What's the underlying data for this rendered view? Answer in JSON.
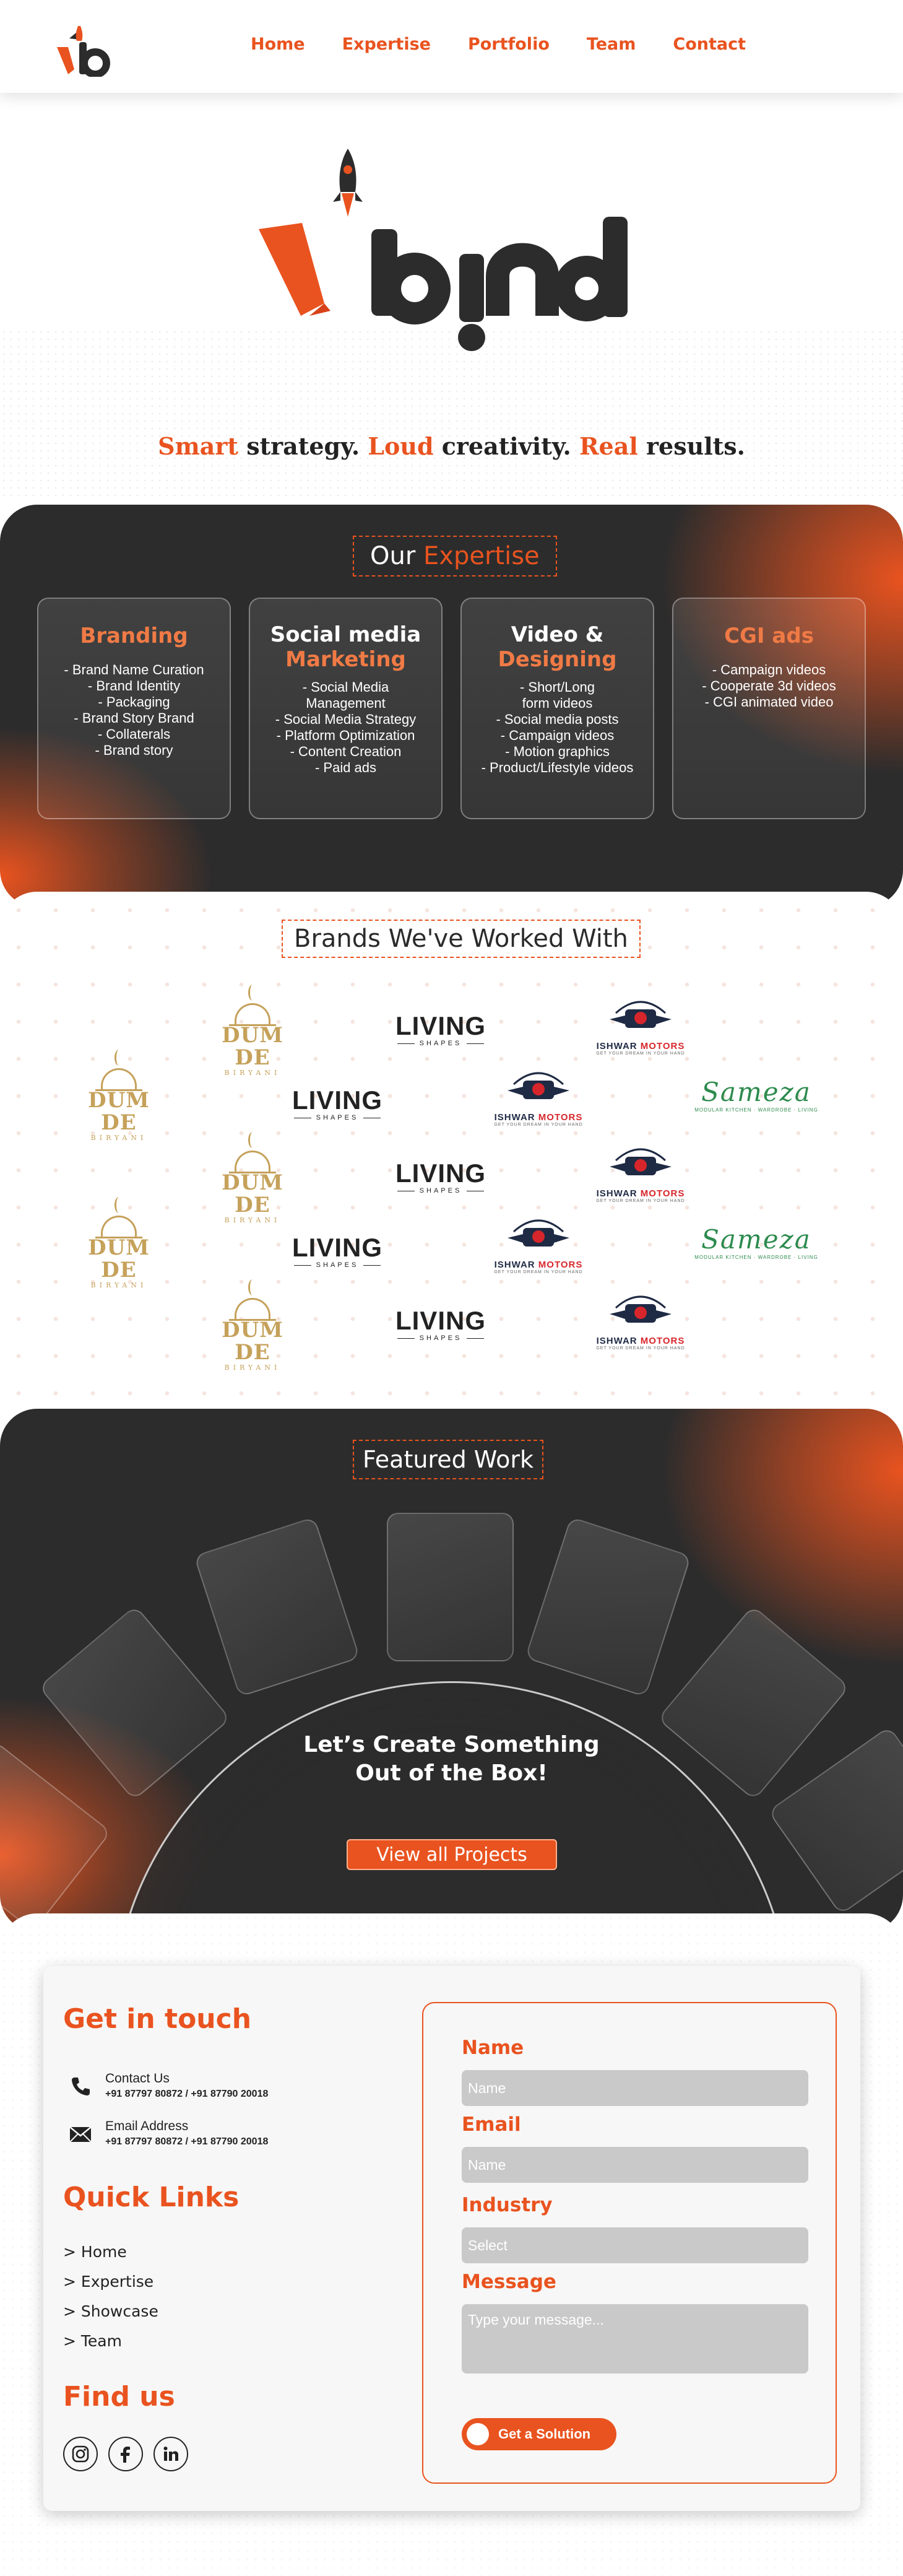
{
  "brand": {
    "logo_text": "vbind",
    "accent": "#E9531F",
    "dark": "#2C2C2C"
  },
  "nav": {
    "links": [
      "Home",
      "Expertise",
      "Portfolio",
      "Team",
      "Contact"
    ]
  },
  "hero": {
    "tagline": {
      "w1": "Smart",
      "t1": " strategy. ",
      "w2": "Loud",
      "t2": " creativity. ",
      "w3": "Real",
      "t3": " results."
    }
  },
  "expertise": {
    "title_a": "Our ",
    "title_b": "Expertise",
    "cards": [
      {
        "title_a": "Branding",
        "title_b": "",
        "items": [
          "- Brand Name Curation",
          "- Brand Identity",
          "- Packaging",
          "- Brand Story Brand",
          "- Collaterals",
          "- Brand story"
        ]
      },
      {
        "title_a": "Social media",
        "title_b": "Marketing",
        "items": [
          "- Social Media",
          "Management",
          "- Social Media Strategy",
          "- Platform Optimization",
          "- Content Creation",
          "- Paid ads"
        ]
      },
      {
        "title_a": "Video &",
        "title_b": "Designing",
        "items": [
          "- Short/Long",
          "form videos",
          "- Social media posts",
          "- Campaign videos",
          "- Motion graphics",
          "- Product/Lifestyle videos"
        ]
      },
      {
        "title_a": "CGI ads",
        "title_b": "",
        "items": [
          "- Campaign videos",
          "- Cooperate 3d videos",
          "- CGI animated video"
        ]
      }
    ]
  },
  "brands": {
    "title": "Brands We've Worked With",
    "dumde": {
      "name": "DUM DE",
      "sub": "BIRYANI"
    },
    "living": {
      "name": "LIVING",
      "sub": "SHAPES"
    },
    "ishwar": {
      "name_a": "ISHWAR ",
      "name_b": "MOTORS",
      "sub": "GET YOUR DREAM IN YOUR HAND"
    },
    "sameza": {
      "name": "Sameza",
      "sub": "MODULAR KITCHEN · WARDROBE · LIVING"
    }
  },
  "featured": {
    "title": "Featured Work",
    "heading_line1": "Let’s Create Something",
    "heading_line2": "Out of the Box!",
    "button": "View all Projects"
  },
  "contact": {
    "get_in_touch": "Get in touch",
    "phone_label": "Contact Us",
    "phone_value": "+91 87797 80872 / +91 87790 20018",
    "email_label": "Email Address",
    "email_value": "+91 87797 80872 / +91 87790 20018",
    "quick_links_title": "Quick Links",
    "quick_links": [
      "> Home",
      "> Expertise",
      "> Showcase",
      "> Team"
    ],
    "find_us": "Find us",
    "social_icons": [
      "instagram-icon",
      "facebook-icon",
      "linkedin-icon"
    ]
  },
  "form": {
    "name_label": "Name",
    "name_placeholder": "Name",
    "email_label": "Email",
    "email_placeholder": "Name",
    "industry_label": "Industry",
    "industry_placeholder": "Select",
    "message_label": "Message",
    "message_placeholder": "Type your message...",
    "submit": "Get a Solution"
  }
}
